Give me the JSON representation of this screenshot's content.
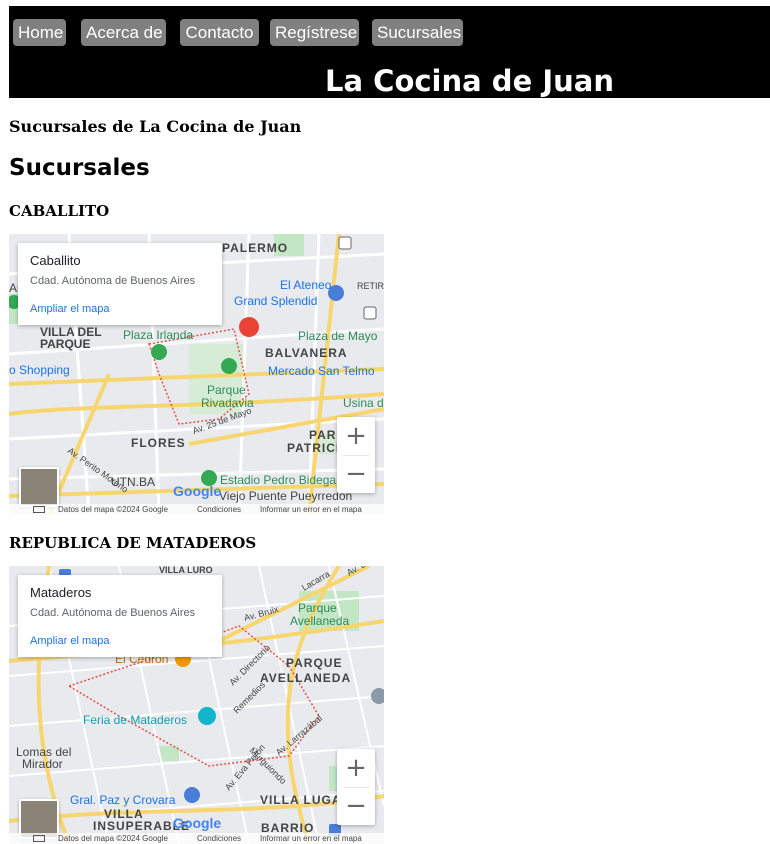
{
  "nav": {
    "items": [
      {
        "label": "Home"
      },
      {
        "label": "Acerca de"
      },
      {
        "label": "Contacto"
      },
      {
        "label": "Regístrese"
      },
      {
        "label": "Sucursales"
      }
    ]
  },
  "site": {
    "title": "La Cocina de Juan"
  },
  "page": {
    "heading": "Sucursales de La Cocina de Juan",
    "section_title": "Sucursales"
  },
  "branches": [
    {
      "name": "CABALLITO",
      "map": {
        "place": "Caballito",
        "region": "Cdad. Autónoma de Buenos Aires",
        "link": "Ampliar el mapa",
        "labels": {
          "l1": "PALERMO",
          "l2": "El Ateneo",
          "l3": "Grand Splendid",
          "l4": "RETIR",
          "l5": "VILLA DEL",
          "l6": "PARQUE",
          "l7": "Plaza Irlanda",
          "l8": "Plaza de Mayo",
          "l9": "BALVANERA",
          "l10": "Mercado San Telmo",
          "l11": "o Shopping",
          "l12": "Parque",
          "l13": "Rivadavia",
          "l14": "Usina de",
          "l15": "FLORES",
          "l16": "PARQU",
          "l17": "PATRICIO",
          "l18": "Estadio Pedro Bidegain",
          "l19": "Viejo Puente Pueyrredón",
          "l20": "UTN.BA",
          "l21": "Av. 25 de Mayo",
          "l22": "Av. Perito Moreno",
          "l23": "Ar"
        }
      }
    },
    {
      "name": "REPUBLICA DE MATADEROS",
      "map": {
        "place": "Mataderos",
        "region": "Cdad. Autónoma de Buenos Aires",
        "link": "Ampliar el mapa",
        "labels": {
          "l1": "VILLA LURO",
          "l2": "Parque",
          "l3": "Avellaneda",
          "l4": "El Cedrón",
          "l5": "PARQUE",
          "l6": "AVELLANEDA",
          "l7": "Feria de Mataderos",
          "l8": "Lomas del",
          "l9": "Mirador",
          "l10": "Gral. Paz y Crovara",
          "l11": "VILLA LUGA",
          "l12": "VILLA",
          "l13": "INSUPERABLE",
          "l14": "BARRIO",
          "l15": "Av. Directorio",
          "l16": "Remedios",
          "l17": "Av. Larrazábal",
          "l18": "Murguiondo",
          "l19": "Av. Eva Perón",
          "l20": "Av. Bruix",
          "l21": "Lacarra",
          "l22": "Av. Dire"
        }
      }
    }
  ],
  "map_common": {
    "google": "Google",
    "footer_data": "Datos del mapa ©2024 Google",
    "footer_terms": "Condiciones",
    "footer_report": "Informar un error en el mapa",
    "zoom_in": "+",
    "zoom_out": "−"
  },
  "colors": {
    "header_bg": "#000000",
    "nav_button_bg": "#808080",
    "map_link": "#1a73e8",
    "park_green": "#c3e6c4",
    "road_yellow": "#f8d66f"
  }
}
